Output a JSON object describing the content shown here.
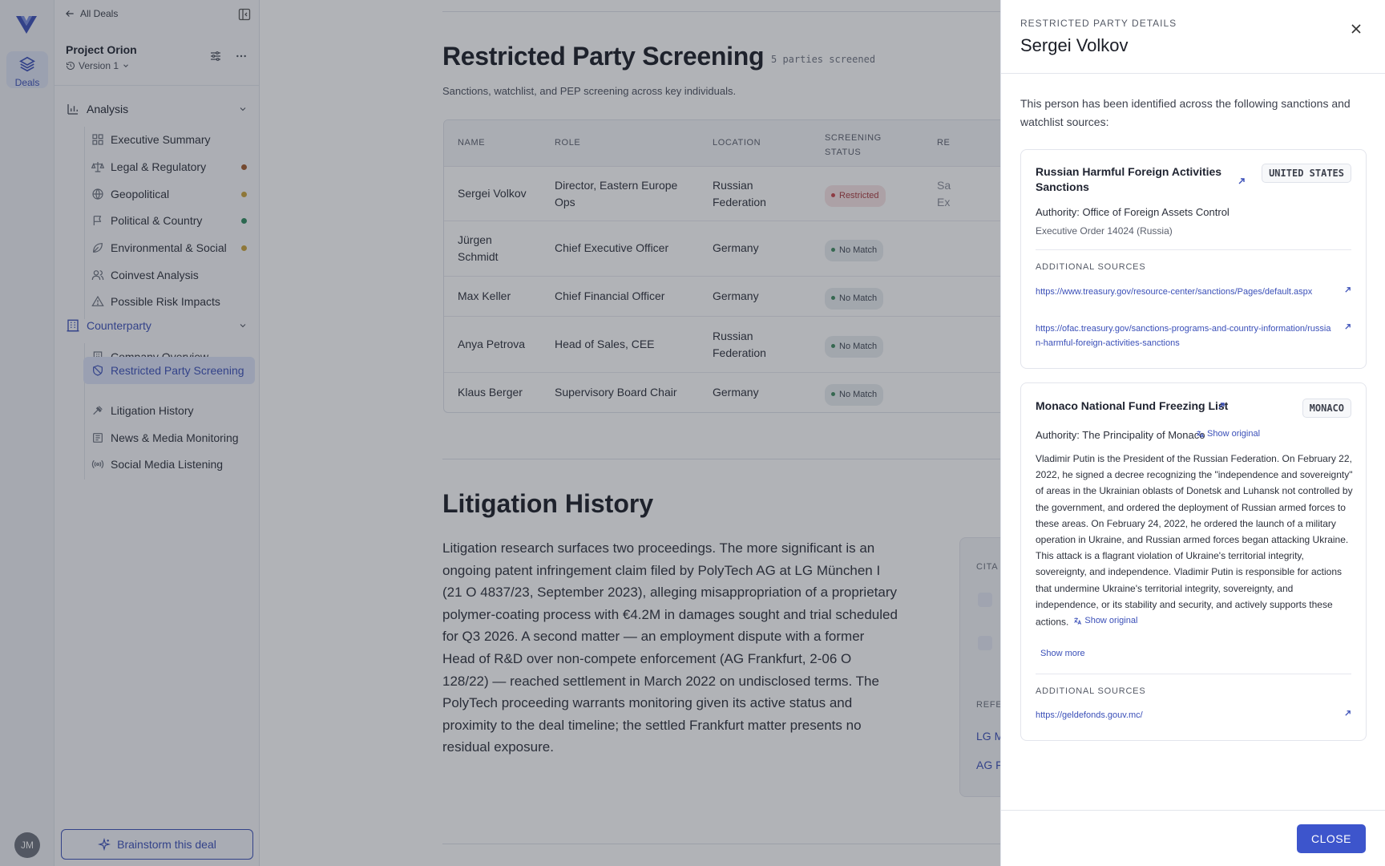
{
  "rail": {
    "deals_label": "Deals",
    "avatar_initials": "JM"
  },
  "sidebar": {
    "back_label": "All Deals",
    "project_name": "Project Orion",
    "version_label": "Version 1",
    "analysis_label": "Analysis",
    "analysis_items": [
      {
        "label": "Executive Summary",
        "dot": ""
      },
      {
        "label": "Legal & Regulatory",
        "dot": "#a05a2c"
      },
      {
        "label": "Geopolitical",
        "dot": "#c9a23a"
      },
      {
        "label": "Political & Country",
        "dot": "#2f8a5e"
      },
      {
        "label": "Environmental & Social",
        "dot": "#c9a23a"
      },
      {
        "label": "Coinvest Analysis",
        "dot": ""
      },
      {
        "label": "Possible Risk Impacts",
        "dot": ""
      }
    ],
    "counterparty_label": "Counterparty",
    "counterparty_items": [
      {
        "label": "Company Overview"
      },
      {
        "label": "Restricted Party Screening"
      },
      {
        "label": "Litigation History"
      },
      {
        "label": "News & Media Monitoring"
      },
      {
        "label": "Social Media Listening"
      }
    ],
    "brainstorm_label": "Brainstorm this deal"
  },
  "main": {
    "title": "Restricted Party Screening",
    "count": "5 parties screened",
    "subtitle": "Sanctions, watchlist, and PEP screening across key individuals.",
    "columns": {
      "name": "NAME",
      "role": "ROLE",
      "location": "LOCATION",
      "status_1": "SCREENING",
      "status_2": "STATUS",
      "reason": "RE"
    },
    "rows": [
      {
        "name_1": "Sergei Volkov",
        "name_2": "",
        "role_1": "Director, Eastern Europe",
        "role_2": "Ops",
        "loc_1": "Russian",
        "loc_2": "Federation",
        "status": "Restricted",
        "reason_1": "Sa",
        "reason_2": "Ex"
      },
      {
        "name_1": "Jürgen",
        "name_2": "Schmidt",
        "role_1": "Chief Executive Officer",
        "role_2": "",
        "loc_1": "Germany",
        "loc_2": "",
        "status": "No Match",
        "reason_1": "",
        "reason_2": ""
      },
      {
        "name_1": "Max Keller",
        "name_2": "",
        "role_1": "Chief Financial Officer",
        "role_2": "",
        "loc_1": "Germany",
        "loc_2": "",
        "status": "No Match",
        "reason_1": "",
        "reason_2": ""
      },
      {
        "name_1": "Anya Petrova",
        "name_2": "",
        "role_1": "Head of Sales, CEE",
        "role_2": "",
        "loc_1": "Russian",
        "loc_2": "Federation",
        "status": "No Match",
        "reason_1": "",
        "reason_2": ""
      },
      {
        "name_1": "Klaus Berger",
        "name_2": "",
        "role_1": "Supervisory Board Chair",
        "role_2": "",
        "loc_1": "Germany",
        "loc_2": "",
        "status": "No Match",
        "reason_1": "",
        "reason_2": ""
      }
    ],
    "litigation_title": "Litigation History",
    "litigation_text": "Litigation research surfaces two proceedings. The more significant is an ongoing patent infringement claim filed by PolyTech AG at LG München I (21 O 4837/23, September 2023), alleging misappropriation of a proprietary polymer-coating process with €4.2M in damages sought and trial scheduled for Q3 2026. A second matter — an employment dispute with a former Head of R&D over non-compete enforcement (AG Frankfurt, 2-06 O 128/22) — reached settlement in March 2022 on undisclosed terms. The PolyTech proceeding warrants monitoring given its active status and proximity to the deal timeline; the settled Frankfurt matter presents no residual exposure.",
    "citations_label": "CITA",
    "references_label": "REFE",
    "ref_links": [
      "LG M",
      "AG F"
    ]
  },
  "drawer": {
    "kicker": "RESTRICTED PARTY DETAILS",
    "title": "Sergei Volkov",
    "intro": "This person has been identified across the following sanctions and watchlist sources:",
    "card1": {
      "title": "Russian Harmful Foreign Activities Sanctions",
      "tag": "UNITED STATES",
      "authority": "Authority: Office of Foreign Assets Control",
      "sub": "Executive Order 14024 (Russia)",
      "sources_label": "ADDITIONAL SOURCES",
      "links": [
        "https://www.treasury.gov/resource-center/sanctions/Pages/default.aspx",
        "https://ofac.treasury.gov/sanctions-programs-and-country-information/russian-harmful-foreign-activities-sanctions"
      ]
    },
    "card2": {
      "title": "Monaco National Fund Freezing List",
      "tag": "MONACO",
      "authority": "Authority: The Principality of Monaco",
      "show_original": "Show original",
      "body": "Vladimir Putin is the President of the Russian Federation. On February 22, 2022, he signed a decree recognizing the \"independence and sovereignty\" of areas in the Ukrainian oblasts of Donetsk and Luhansk not controlled by the government, and ordered the deployment of Russian armed forces to these areas. On February 24, 2022, he ordered the launch of a military operation in Ukraine, and Russian armed forces began attacking Ukraine. This attack is a flagrant violation of Ukraine's territorial integrity, sovereignty, and independence. Vladimir Putin is responsible for actions that undermine Ukraine's territorial integrity, sovereignty, and independence, or its stability and security, and actively supports these actions.",
      "show_more": "Show more",
      "sources_label": "ADDITIONAL SOURCES",
      "link": "https://geldefonds.gouv.mc/"
    },
    "close_label": "CLOSE"
  },
  "colors": {
    "accent": "#3a4fb8",
    "button": "#3d55cc",
    "restricted": "#a83a3f"
  }
}
